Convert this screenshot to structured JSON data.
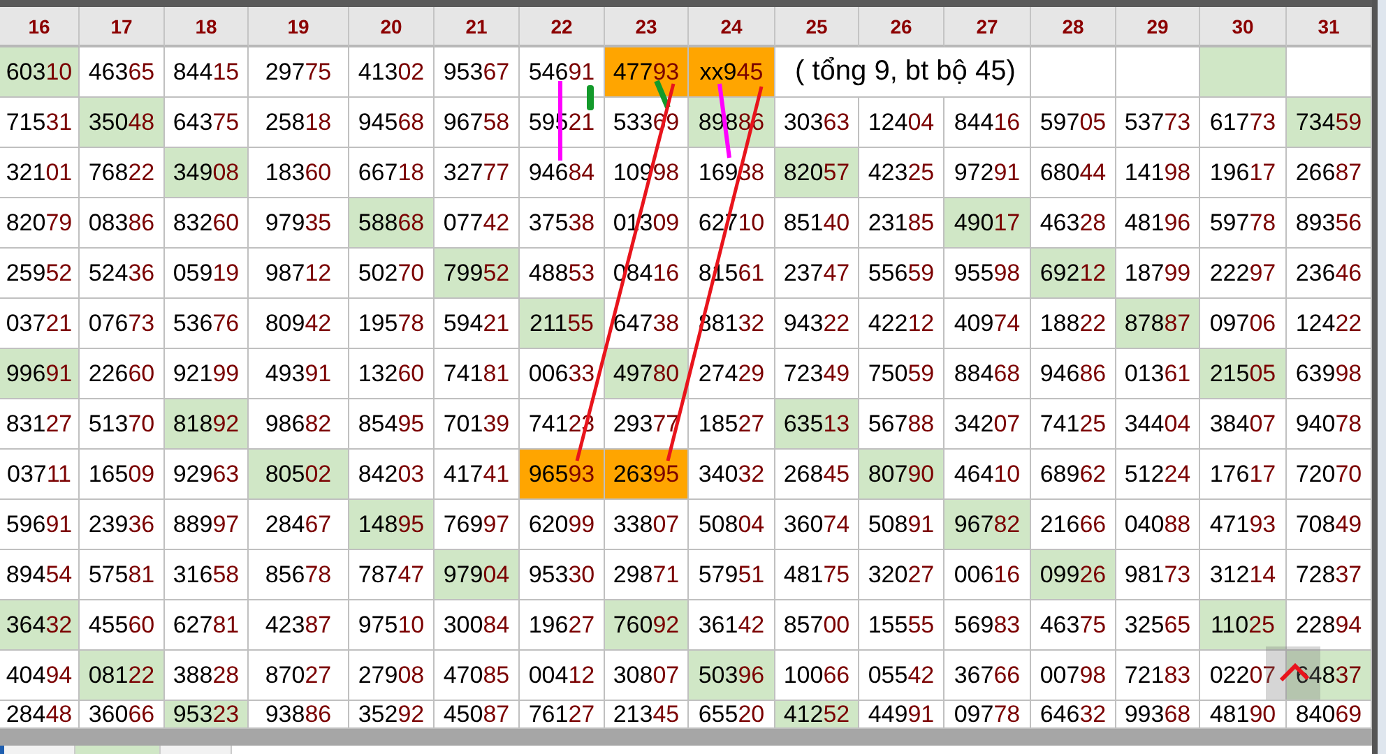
{
  "table": {
    "columns": [
      "16",
      "17",
      "18",
      "19",
      "20",
      "21",
      "22",
      "23",
      "24",
      "25",
      "26",
      "27",
      "28",
      "29",
      "30",
      "31"
    ],
    "rows": [
      [
        {
          "text": "60310",
          "color": "#d0e7c6"
        },
        {
          "text": "46365"
        },
        {
          "text": "84415"
        },
        {
          "text": "29775"
        },
        {
          "text": "41302"
        },
        {
          "text": "95367"
        },
        {
          "text": "54691"
        },
        {
          "text": "47793",
          "color": "#ffa500"
        },
        {
          "text": "xx945",
          "color": "#ffa500"
        },
        {
          "text": "( tổng 9, bt bộ 45)",
          "kind": "note"
        },
        {
          "kind": "empty"
        },
        {
          "kind": "empty"
        },
        {
          "kind": "empty",
          "color": "#d0e7c6"
        },
        {
          "kind": "empty"
        }
      ],
      [
        {
          "text": "71531"
        },
        {
          "text": "35048",
          "color": "#d0e7c6"
        },
        {
          "text": "64375"
        },
        {
          "text": "25818"
        },
        {
          "text": "94568"
        },
        {
          "text": "96758"
        },
        {
          "text": "59521"
        },
        {
          "text": "53369"
        },
        {
          "text": "89886",
          "color": "#d0e7c6"
        },
        {
          "text": "30363"
        },
        {
          "text": "12404"
        },
        {
          "text": "84416"
        },
        {
          "text": "59705"
        },
        {
          "text": "53773"
        },
        {
          "text": "61773"
        },
        {
          "text": "73459",
          "color": "#d0e7c6"
        }
      ],
      [
        {
          "text": "32101"
        },
        {
          "text": "76822"
        },
        {
          "text": "34908",
          "color": "#d0e7c6"
        },
        {
          "text": "18360"
        },
        {
          "text": "66718"
        },
        {
          "text": "32777"
        },
        {
          "text": "94684"
        },
        {
          "text": "10998"
        },
        {
          "text": "16938"
        },
        {
          "text": "82057",
          "color": "#d0e7c6"
        },
        {
          "text": "42325"
        },
        {
          "text": "97291"
        },
        {
          "text": "68044"
        },
        {
          "text": "14198"
        },
        {
          "text": "19617"
        },
        {
          "text": "26687"
        }
      ],
      [
        {
          "text": "82079"
        },
        {
          "text": "08386"
        },
        {
          "text": "83260"
        },
        {
          "text": "97935"
        },
        {
          "text": "58868",
          "color": "#d0e7c6"
        },
        {
          "text": "07742"
        },
        {
          "text": "37538"
        },
        {
          "text": "01309"
        },
        {
          "text": "62710"
        },
        {
          "text": "85140"
        },
        {
          "text": "23185"
        },
        {
          "text": "49017",
          "color": "#d0e7c6"
        },
        {
          "text": "46328"
        },
        {
          "text": "48196"
        },
        {
          "text": "59778"
        },
        {
          "text": "89356"
        }
      ],
      [
        {
          "text": "25952"
        },
        {
          "text": "52436"
        },
        {
          "text": "05919"
        },
        {
          "text": "98712"
        },
        {
          "text": "50270"
        },
        {
          "text": "79952",
          "color": "#d0e7c6"
        },
        {
          "text": "48853"
        },
        {
          "text": "08416"
        },
        {
          "text": "81561"
        },
        {
          "text": "23747"
        },
        {
          "text": "55659"
        },
        {
          "text": "95598"
        },
        {
          "text": "69212",
          "color": "#d0e7c6"
        },
        {
          "text": "18799"
        },
        {
          "text": "22297"
        },
        {
          "text": "23646"
        }
      ],
      [
        {
          "text": "03721"
        },
        {
          "text": "07673"
        },
        {
          "text": "53676"
        },
        {
          "text": "80942"
        },
        {
          "text": "19578"
        },
        {
          "text": "59421"
        },
        {
          "text": "21155",
          "color": "#d0e7c6"
        },
        {
          "text": "64738"
        },
        {
          "text": "88132"
        },
        {
          "text": "94322"
        },
        {
          "text": "42212"
        },
        {
          "text": "40974"
        },
        {
          "text": "18822"
        },
        {
          "text": "87887",
          "color": "#d0e7c6"
        },
        {
          "text": "09706"
        },
        {
          "text": "12422"
        }
      ],
      [
        {
          "text": "99691",
          "color": "#d0e7c6"
        },
        {
          "text": "22660"
        },
        {
          "text": "92199"
        },
        {
          "text": "49391"
        },
        {
          "text": "13260"
        },
        {
          "text": "74181"
        },
        {
          "text": "00633"
        },
        {
          "text": "49780",
          "color": "#d0e7c6"
        },
        {
          "text": "27429"
        },
        {
          "text": "72349"
        },
        {
          "text": "75059"
        },
        {
          "text": "88468"
        },
        {
          "text": "94686"
        },
        {
          "text": "01361"
        },
        {
          "text": "21505",
          "color": "#d0e7c6"
        },
        {
          "text": "63998"
        }
      ],
      [
        {
          "text": "83127"
        },
        {
          "text": "51370"
        },
        {
          "text": "81892",
          "color": "#d0e7c6"
        },
        {
          "text": "98682"
        },
        {
          "text": "85495"
        },
        {
          "text": "70139"
        },
        {
          "text": "74123"
        },
        {
          "text": "29377"
        },
        {
          "text": "18527"
        },
        {
          "text": "63513",
          "color": "#d0e7c6"
        },
        {
          "text": "56788"
        },
        {
          "text": "34207"
        },
        {
          "text": "74125"
        },
        {
          "text": "34404"
        },
        {
          "text": "38407"
        },
        {
          "text": "94078"
        }
      ],
      [
        {
          "text": "03711"
        },
        {
          "text": "16509"
        },
        {
          "text": "92963"
        },
        {
          "text": "80502",
          "color": "#d0e7c6"
        },
        {
          "text": "84203"
        },
        {
          "text": "41741"
        },
        {
          "text": "96593",
          "color": "#ffa500"
        },
        {
          "text": "26395",
          "color": "#ffa500"
        },
        {
          "text": "34032"
        },
        {
          "text": "26845"
        },
        {
          "text": "80790",
          "color": "#d0e7c6"
        },
        {
          "text": "46410"
        },
        {
          "text": "68962"
        },
        {
          "text": "51224"
        },
        {
          "text": "17617"
        },
        {
          "text": "72070"
        }
      ],
      [
        {
          "text": "59691"
        },
        {
          "text": "23936"
        },
        {
          "text": "88997"
        },
        {
          "text": "28467"
        },
        {
          "text": "14895",
          "color": "#d0e7c6"
        },
        {
          "text": "76997"
        },
        {
          "text": "62099"
        },
        {
          "text": "33807"
        },
        {
          "text": "50804"
        },
        {
          "text": "36074"
        },
        {
          "text": "50891"
        },
        {
          "text": "96782",
          "color": "#d0e7c6"
        },
        {
          "text": "21666"
        },
        {
          "text": "04088"
        },
        {
          "text": "47193"
        },
        {
          "text": "70849"
        }
      ],
      [
        {
          "text": "89454"
        },
        {
          "text": "57581"
        },
        {
          "text": "31658"
        },
        {
          "text": "85678"
        },
        {
          "text": "78747"
        },
        {
          "text": "97904",
          "color": "#d0e7c6"
        },
        {
          "text": "95330"
        },
        {
          "text": "29871"
        },
        {
          "text": "57951"
        },
        {
          "text": "48175"
        },
        {
          "text": "32027"
        },
        {
          "text": "00616"
        },
        {
          "text": "09926",
          "color": "#d0e7c6"
        },
        {
          "text": "98173"
        },
        {
          "text": "31214"
        },
        {
          "text": "72837"
        }
      ],
      [
        {
          "text": "36432",
          "color": "#d0e7c6"
        },
        {
          "text": "45560"
        },
        {
          "text": "62781"
        },
        {
          "text": "42387"
        },
        {
          "text": "97510"
        },
        {
          "text": "30084"
        },
        {
          "text": "19627"
        },
        {
          "text": "76092",
          "color": "#d0e7c6"
        },
        {
          "text": "36142"
        },
        {
          "text": "85700"
        },
        {
          "text": "15555"
        },
        {
          "text": "56983"
        },
        {
          "text": "46375"
        },
        {
          "text": "32565"
        },
        {
          "text": "11025",
          "color": "#d0e7c6"
        },
        {
          "text": "22894"
        }
      ],
      [
        {
          "text": "40494"
        },
        {
          "text": "08122",
          "color": "#d0e7c6"
        },
        {
          "text": "38828"
        },
        {
          "text": "87027"
        },
        {
          "text": "27908"
        },
        {
          "text": "47085"
        },
        {
          "text": "00412"
        },
        {
          "text": "30807"
        },
        {
          "text": "50396",
          "color": "#d0e7c6"
        },
        {
          "text": "10066"
        },
        {
          "text": "05542"
        },
        {
          "text": "36766"
        },
        {
          "text": "00798"
        },
        {
          "text": "72183"
        },
        {
          "text": "02207"
        },
        {
          "text": "64837",
          "color": "#d0e7c6"
        }
      ],
      [
        {
          "text": "28448"
        },
        {
          "text": "36066"
        },
        {
          "text": "95323",
          "color": "#d0e7c6"
        },
        {
          "text": "93886"
        },
        {
          "text": "35292"
        },
        {
          "text": "45087"
        },
        {
          "text": "76127"
        },
        {
          "text": "21345"
        },
        {
          "text": "65520"
        },
        {
          "text": "41252",
          "color": "#d0e7c6"
        },
        {
          "text": "44991"
        },
        {
          "text": "09778"
        },
        {
          "text": "64632"
        },
        {
          "text": "99368"
        },
        {
          "text": "48190"
        },
        {
          "text": "84069"
        }
      ]
    ]
  }
}
